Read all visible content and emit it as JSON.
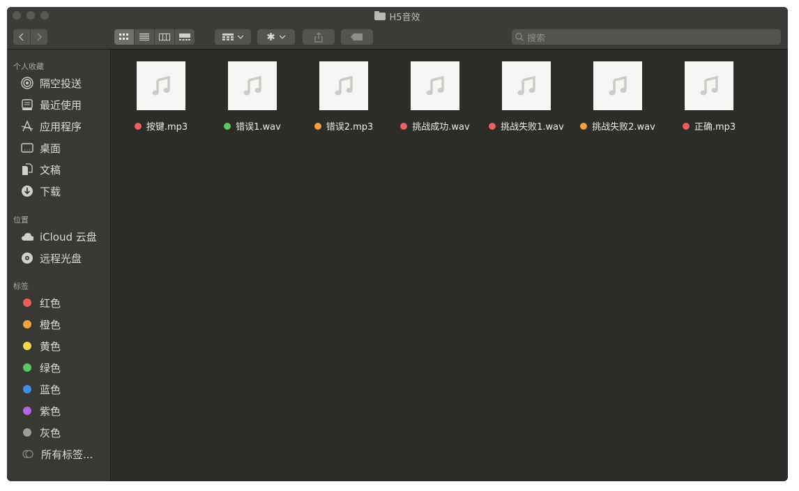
{
  "window": {
    "title": "H5音效"
  },
  "toolbar": {
    "back_icon": "chevron-left-icon",
    "forward_icon": "chevron-right-icon",
    "view_modes": [
      "icon-view-icon",
      "list-view-icon",
      "column-view-icon",
      "gallery-view-icon"
    ],
    "group_icon": "group-icon",
    "action_icon": "gear-icon",
    "share_icon": "share-icon",
    "tag_icon": "tag-icon",
    "search_placeholder": "搜索"
  },
  "sidebar": {
    "favorites_title": "个人收藏",
    "favorites": [
      {
        "label": "隔空投送",
        "icon": "airdrop-icon"
      },
      {
        "label": "最近使用",
        "icon": "recents-icon"
      },
      {
        "label": "应用程序",
        "icon": "applications-icon"
      },
      {
        "label": "桌面",
        "icon": "desktop-icon"
      },
      {
        "label": "文稿",
        "icon": "documents-icon"
      },
      {
        "label": "下载",
        "icon": "downloads-icon"
      }
    ],
    "locations_title": "位置",
    "locations": [
      {
        "label": "iCloud 云盘",
        "icon": "cloud-icon"
      },
      {
        "label": "远程光盘",
        "icon": "disc-icon"
      }
    ],
    "tags_title": "标签",
    "tags": [
      {
        "label": "红色",
        "color": "#ec5f5a"
      },
      {
        "label": "橙色",
        "color": "#f3a33a"
      },
      {
        "label": "黄色",
        "color": "#f6d74a"
      },
      {
        "label": "绿色",
        "color": "#5ac85c"
      },
      {
        "label": "蓝色",
        "color": "#3d8fef"
      },
      {
        "label": "紫色",
        "color": "#b565e0"
      },
      {
        "label": "灰色",
        "color": "#9e9e9b"
      }
    ],
    "all_tags_label": "所有标签..."
  },
  "files": [
    {
      "name": "按键.mp3",
      "tag_color": "#ec5f5a",
      "icon": "audio-file-icon"
    },
    {
      "name": "错误1.wav",
      "tag_color": "#5ac85c",
      "icon": "audio-file-icon"
    },
    {
      "name": "错误2.mp3",
      "tag_color": "#f3a33a",
      "icon": "audio-file-icon"
    },
    {
      "name": "挑战成功.wav",
      "tag_color": "#ec5f5a",
      "icon": "audio-file-icon"
    },
    {
      "name": "挑战失败1.wav",
      "tag_color": "#ec5f5a",
      "icon": "audio-file-icon"
    },
    {
      "name": "挑战失败2.wav",
      "tag_color": "#f3a33a",
      "icon": "audio-file-icon"
    },
    {
      "name": "正确.mp3",
      "tag_color": "#ec5f5a",
      "icon": "audio-file-icon"
    }
  ]
}
